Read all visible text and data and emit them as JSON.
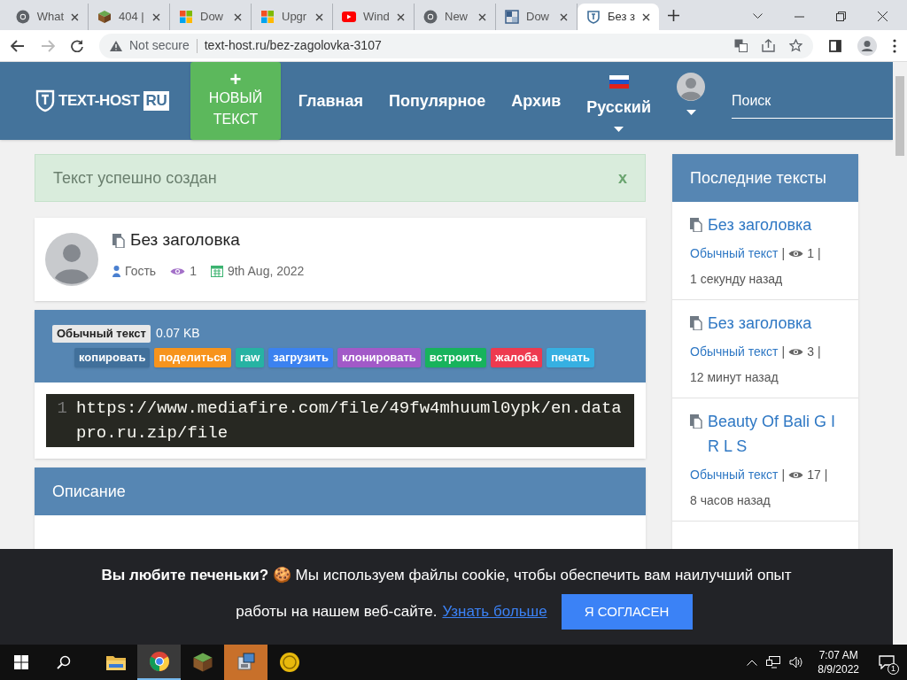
{
  "browser": {
    "tabs": [
      {
        "title": "What",
        "kind": "chrome",
        "selected": false
      },
      {
        "title": "404 |",
        "kind": "cube",
        "selected": false
      },
      {
        "title": "Dow",
        "kind": "windows",
        "selected": false
      },
      {
        "title": "Upgr",
        "kind": "windows",
        "selected": false
      },
      {
        "title": "Wind",
        "kind": "youtube",
        "selected": false
      },
      {
        "title": "New",
        "kind": "chrome",
        "selected": false
      },
      {
        "title": "Dow",
        "kind": "squares",
        "selected": false
      },
      {
        "title": "Без з",
        "kind": "site",
        "selected": true
      }
    ],
    "security": "Not secure",
    "url": "text-host.ru/bez-zagolovka-3107"
  },
  "header": {
    "logo": "TEXT-HOST",
    "logo_badge": "RU",
    "new_button": {
      "plus": "+",
      "label": "НОВЫЙ ТЕКСТ"
    },
    "nav": [
      "Главная",
      "Популярное",
      "Архив"
    ],
    "language": "Русский",
    "search": {
      "placeholder": "Поиск"
    }
  },
  "alert": {
    "text": "Текст успешно создан",
    "close": "x"
  },
  "paste": {
    "title": "Без заголовка",
    "author": "Гость",
    "views": "1",
    "date": "9th Aug, 2022"
  },
  "toolbar": {
    "syntax": "Обычный текст",
    "size": "0.07 KB",
    "actions": [
      {
        "label": "копировать",
        "color": "#41709b"
      },
      {
        "label": "поделиться",
        "color": "#f7941d"
      },
      {
        "label": "raw",
        "color": "#26b3a3"
      },
      {
        "label": "загрузить",
        "color": "#3b82f0"
      },
      {
        "label": "клонировать",
        "color": "#a259c8"
      },
      {
        "label": "встроить",
        "color": "#17b35c"
      },
      {
        "label": "жалоба",
        "color": "#ee3a4f"
      },
      {
        "label": "печать",
        "color": "#36b0e2"
      }
    ]
  },
  "code": {
    "lines": [
      {
        "number": "1",
        "text": "https://www.mediafire.com/file/49fw4mhuuml0ypk/en.datapro.ru.zip/file"
      }
    ]
  },
  "description": {
    "title": "Описание"
  },
  "sidebar": {
    "title": "Последние тексты",
    "items": [
      {
        "title": "Без заголовка",
        "type": "Обычный текст",
        "divider_1": "|",
        "views": "1",
        "divider_2": "|",
        "time": "1 секунду назад"
      },
      {
        "title": "Без заголовка",
        "type": "Обычный текст",
        "divider_1": "|",
        "views": "3",
        "divider_2": "|",
        "time": "12 минут назад"
      },
      {
        "title": "Beauty Of Bali G I R L S",
        "type": "Обычный текст",
        "divider_1": "|",
        "views": "17",
        "divider_2": "|",
        "time": "8 часов назад"
      }
    ]
  },
  "cookie": {
    "lines": [
      "**Вы любите печеньки?** 🍪 Мы используем файлы cookie, чтобы обеспечить вам наилучший опыт",
      "работы на нашем веб-сайте."
    ],
    "link": "Узнать больше",
    "button": "Я СОГЛАСЕН"
  },
  "taskbar": {
    "apps": [
      {
        "kind": "folder",
        "selected": false,
        "flashing": false
      },
      {
        "kind": "chrome",
        "selected": true,
        "flashing": false
      },
      {
        "kind": "cube",
        "selected": false,
        "flashing": false
      },
      {
        "kind": "installer",
        "selected": false,
        "flashing": true
      },
      {
        "kind": "coin",
        "selected": false,
        "flashing": false
      }
    ],
    "time": "7:07 AM",
    "date": "8/9/2022",
    "notifications": "1"
  }
}
